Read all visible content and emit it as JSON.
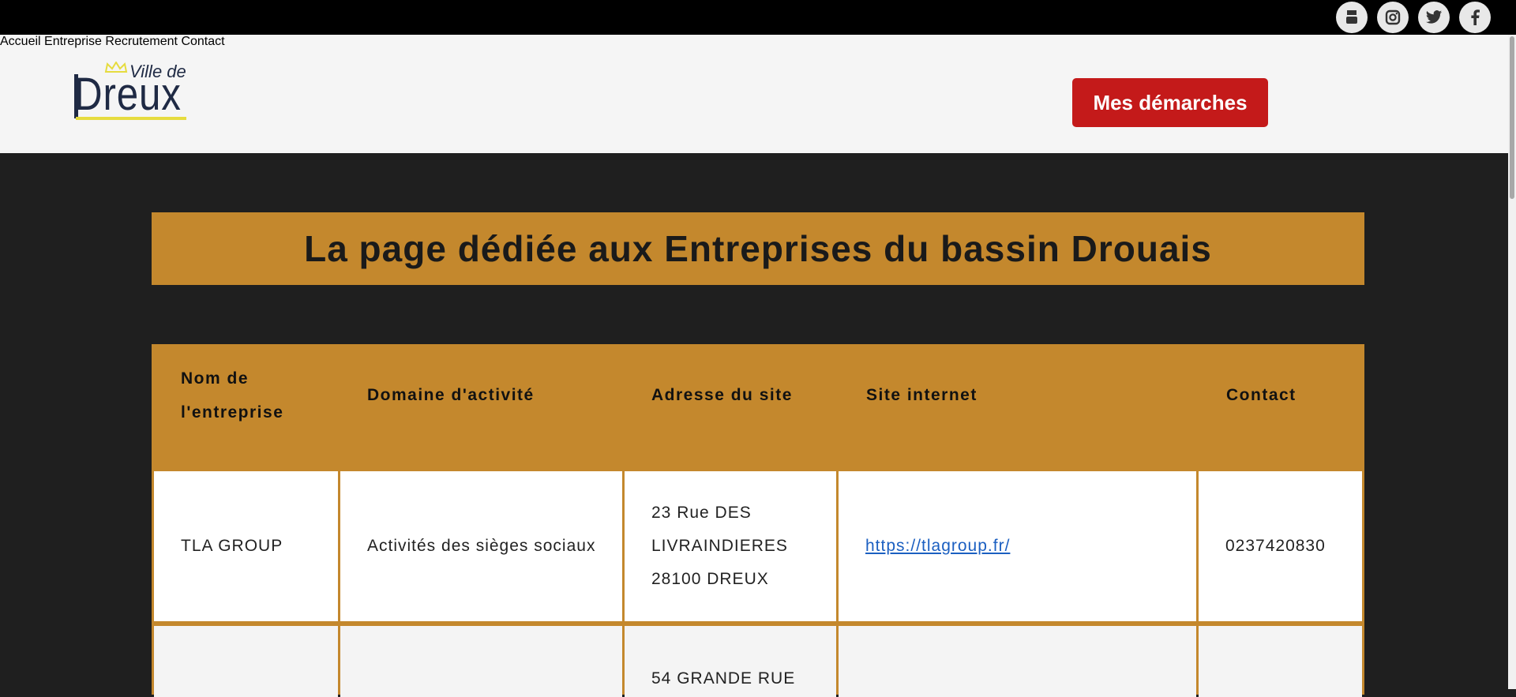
{
  "social": [
    {
      "name": "youtube",
      "icon": "youtube-icon"
    },
    {
      "name": "instagram",
      "icon": "instagram-icon"
    },
    {
      "name": "twitter",
      "icon": "twitter-icon"
    },
    {
      "name": "facebook",
      "icon": "facebook-icon"
    }
  ],
  "logo": {
    "ville": "Ville de",
    "dreux": "Dreux"
  },
  "nav": {
    "items": [
      "Accueil",
      "Entreprise",
      "Recrutement",
      "Contact"
    ],
    "cta": "Mes démarches"
  },
  "colors": {
    "accent": "#c4882d",
    "cta": "#c41a1a",
    "background": "#1f1f1f"
  },
  "banner": {
    "title": "La page dédiée aux Entreprises du bassin Drouais"
  },
  "table": {
    "headers": [
      "Nom de l'entreprise",
      "Domaine d'activité",
      "Adresse du site",
      "Site internet",
      "Contact"
    ],
    "rows": [
      {
        "name": "TLA GROUP",
        "domain": "Activités des sièges sociaux",
        "address": [
          "23 Rue DES",
          "LIVRAINDIERES",
          "28100 DREUX"
        ],
        "website": "https://tlagroup.fr/",
        "contact": "0237420830"
      },
      {
        "name": "",
        "domain": "",
        "address": [
          "54 GRANDE RUE"
        ],
        "website": "",
        "contact": ""
      }
    ]
  }
}
